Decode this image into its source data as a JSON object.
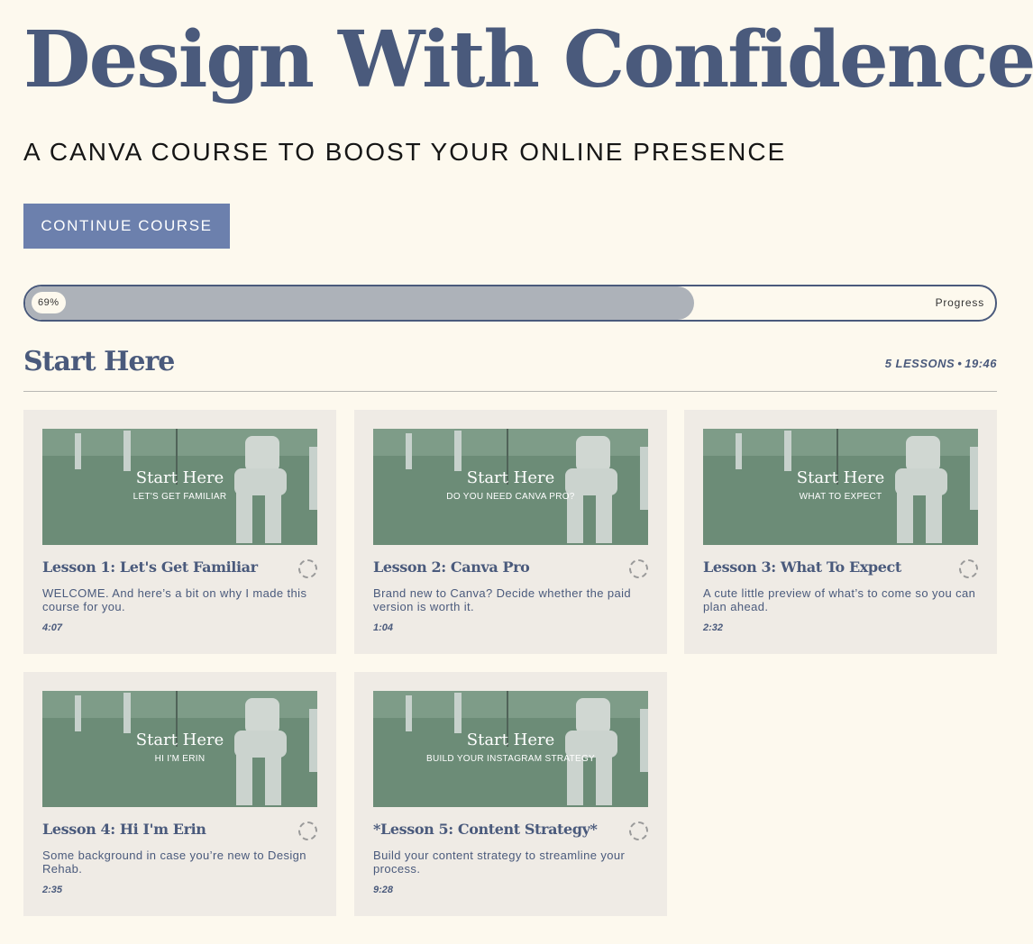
{
  "hero": {
    "title": "Design With Confidence",
    "subtitle": "A CANVA COURSE TO BOOST YOUR ONLINE PRESENCE",
    "cta_label": "CONTINUE COURSE"
  },
  "progress": {
    "percent_label": "69%",
    "value": 0.69,
    "label": "Progress"
  },
  "section": {
    "title": "Start Here",
    "lessons_count": "5 LESSONS",
    "separator": "•",
    "total_duration": "19:46"
  },
  "lessons": [
    {
      "thumb_title": "Start Here",
      "thumb_subtitle": "LET'S GET FAMILIAR",
      "title": "Lesson 1: Let's Get Familiar",
      "description": "WELCOME. And here’s a bit on why I made this course for you.",
      "duration": "4:07"
    },
    {
      "thumb_title": "Start Here",
      "thumb_subtitle": "DO YOU NEED CANVA PRO?",
      "title": "Lesson 2: Canva Pro",
      "description": "Brand new to Canva? Decide whether the paid version is worth it.",
      "duration": "1:04"
    },
    {
      "thumb_title": "Start Here",
      "thumb_subtitle": "WHAT TO EXPECT",
      "title": "Lesson 3: What To Expect",
      "description": "A cute little preview of what’s to come so you can plan ahead.",
      "duration": "2:32"
    },
    {
      "thumb_title": "Start Here",
      "thumb_subtitle": "HI I'M ERIN",
      "title": "Lesson 4: Hi I'm Erin",
      "description": "Some background in case you’re new to Design Rehab.",
      "duration": "2:35"
    },
    {
      "thumb_title": "Start Here",
      "thumb_subtitle": "BUILD YOUR INSTAGRAM STRATEGY",
      "title": "*Lesson 5: Content Strategy*",
      "description": "Build your content strategy to streamline your process.",
      "duration": "9:28"
    }
  ],
  "colors": {
    "accent": "#4a5a7c",
    "button": "#6c80ad",
    "background": "#fdf9ee",
    "card": "#efebe5",
    "progress_fill": "#adb2b9"
  }
}
